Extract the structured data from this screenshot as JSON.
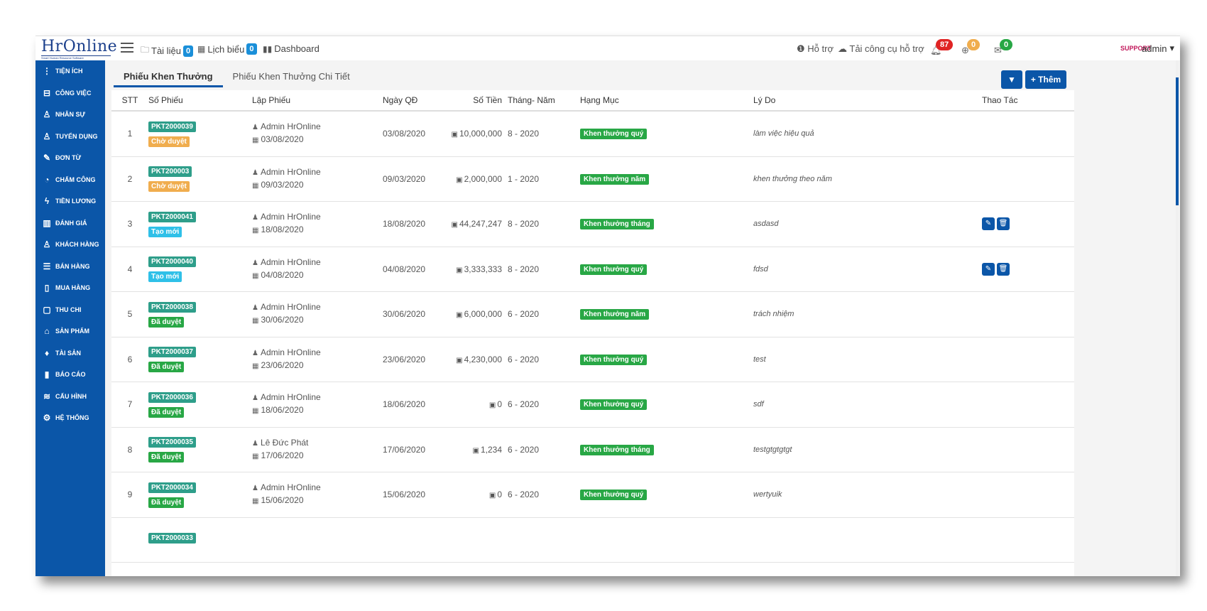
{
  "logo": {
    "text": "HrOnline",
    "sub": "Smart Human Resource Software"
  },
  "topnav": [
    {
      "label": "Tài liệu",
      "count": "0",
      "icon": "folder-icon"
    },
    {
      "label": "Lịch biểu",
      "count": "0",
      "icon": "calendar-icon"
    },
    {
      "label": "Dashboard",
      "icon": "bar-chart-icon"
    }
  ],
  "support": {
    "help": "Hỗ trợ",
    "tools": "Tải công cụ hỗ trợ"
  },
  "notifications": [
    {
      "icon": "bell-icon",
      "count": "87",
      "color": "#e02424"
    },
    {
      "icon": "globe-icon",
      "count": "0",
      "color": "#f0ad4e"
    },
    {
      "icon": "envelope-icon",
      "count": "0",
      "color": "#28a745"
    }
  ],
  "user": {
    "name": "admin",
    "avatar_text": "SUPPORT"
  },
  "sidebar": {
    "items": [
      {
        "label": "TIỆN ÍCH",
        "icon": "vertical-dots-icon"
      },
      {
        "label": "CÔNG VIỆC",
        "icon": "inbox-icon"
      },
      {
        "label": "NHÂN SỰ",
        "icon": "user-icon"
      },
      {
        "label": "TUYỂN DỤNG",
        "icon": "user-icon"
      },
      {
        "label": "ĐƠN TỪ",
        "icon": "edit-icon"
      },
      {
        "label": "CHẤM CÔNG",
        "icon": "gauge-icon"
      },
      {
        "label": "TIỀN LƯƠNG",
        "icon": "bolt-icon"
      },
      {
        "label": "ĐÁNH GIÁ",
        "icon": "book-icon"
      },
      {
        "label": "KHÁCH HÀNG",
        "icon": "user-icon"
      },
      {
        "label": "BÁN HÀNG",
        "icon": "list-icon"
      },
      {
        "label": "MUA HÀNG",
        "icon": "map-icon"
      },
      {
        "label": "THU CHI",
        "icon": "file-icon"
      },
      {
        "label": "SẢN PHẨM",
        "icon": "tag-icon"
      },
      {
        "label": "TÀI SẢN",
        "icon": "diamond-icon"
      },
      {
        "label": "BÁO CÁO",
        "icon": "bar-chart-icon"
      },
      {
        "label": "CẤU HÌNH",
        "icon": "layers-icon"
      },
      {
        "label": "HỆ THỐNG",
        "icon": "gear-icon"
      }
    ]
  },
  "tabs": [
    {
      "label": "Phiếu Khen Thưởng",
      "active": true
    },
    {
      "label": "Phiếu Khen Thưởng Chi Tiết",
      "active": false
    }
  ],
  "toolbar": {
    "add_label": "Thêm"
  },
  "table": {
    "headers": {
      "stt": "STT",
      "code": "Số Phiếu",
      "creator": "Lập Phiếu",
      "date": "Ngày QĐ",
      "amount": "Số Tiền",
      "period": "Tháng- Năm",
      "category": "Hạng Mục",
      "reason": "Lý Do",
      "actions": "Thao Tác"
    },
    "rows": [
      {
        "stt": "1",
        "code": "PKT2000039",
        "status": "Chờ duyệt",
        "status_type": "cho",
        "creator": "Admin HrOnline",
        "created": "03/08/2020",
        "date": "03/08/2020",
        "amount": "10,000,000",
        "period": "8 - 2020",
        "category": "Khen thưởng quý",
        "reason": "làm việc hiệu quả",
        "actions": false
      },
      {
        "stt": "2",
        "code": "PKT200003",
        "status": "Chờ duyệt",
        "status_type": "cho",
        "creator": "Admin HrOnline",
        "created": "09/03/2020",
        "date": "09/03/2020",
        "amount": "2,000,000",
        "period": "1 - 2020",
        "category": "Khen thưởng năm",
        "reason": "khen thưởng theo năm",
        "actions": false
      },
      {
        "stt": "3",
        "code": "PKT2000041",
        "status": "Tạo mới",
        "status_type": "tao",
        "creator": "Admin HrOnline",
        "created": "18/08/2020",
        "date": "18/08/2020",
        "amount": "44,247,247",
        "period": "8 - 2020",
        "category": "Khen thưởng tháng",
        "reason": "asdasd",
        "actions": true
      },
      {
        "stt": "4",
        "code": "PKT2000040",
        "status": "Tạo mới",
        "status_type": "tao",
        "creator": "Admin HrOnline",
        "created": "04/08/2020",
        "date": "04/08/2020",
        "amount": "3,333,333",
        "period": "8 - 2020",
        "category": "Khen thưởng quý",
        "reason": "fdsd",
        "actions": true
      },
      {
        "stt": "5",
        "code": "PKT2000038",
        "status": "Đã duyệt",
        "status_type": "da",
        "creator": "Admin HrOnline",
        "created": "30/06/2020",
        "date": "30/06/2020",
        "amount": "6,000,000",
        "period": "6 - 2020",
        "category": "Khen thưởng năm",
        "reason": "trách nhiệm",
        "actions": false
      },
      {
        "stt": "6",
        "code": "PKT2000037",
        "status": "Đã duyệt",
        "status_type": "da",
        "creator": "Admin HrOnline",
        "created": "23/06/2020",
        "date": "23/06/2020",
        "amount": "4,230,000",
        "period": "6 - 2020",
        "category": "Khen thưởng quý",
        "reason": "test",
        "actions": false
      },
      {
        "stt": "7",
        "code": "PKT2000036",
        "status": "Đã duyệt",
        "status_type": "da",
        "creator": "Admin HrOnline",
        "created": "18/06/2020",
        "date": "18/06/2020",
        "amount": "0",
        "period": "6 - 2020",
        "category": "Khen thưởng quý",
        "reason": "sdf",
        "actions": false
      },
      {
        "stt": "8",
        "code": "PKT2000035",
        "status": "Đã duyệt",
        "status_type": "da",
        "creator": "Lê Đức Phát",
        "created": "17/06/2020",
        "date": "17/06/2020",
        "amount": "1,234",
        "period": "6 - 2020",
        "category": "Khen thưởng tháng",
        "reason": "testgtgtgtgt",
        "actions": false
      },
      {
        "stt": "9",
        "code": "PKT2000034",
        "status": "Đã duyệt",
        "status_type": "da",
        "creator": "Admin HrOnline",
        "created": "15/06/2020",
        "date": "15/06/2020",
        "amount": "0",
        "period": "6 - 2020",
        "category": "Khen thưởng quý",
        "reason": "wertyuik",
        "actions": false
      },
      {
        "stt": "",
        "code": "PKT2000033",
        "status": "",
        "status_type": "",
        "creator": "",
        "created": "",
        "date": "",
        "amount": "",
        "period": "",
        "category": "",
        "reason": "",
        "actions": false
      }
    ]
  },
  "colors": {
    "primary": "#0b56a8",
    "code_badge": "#2e9e8a",
    "pending": "#f0ad4e",
    "new": "#2fc0e8",
    "approved": "#28a745"
  }
}
